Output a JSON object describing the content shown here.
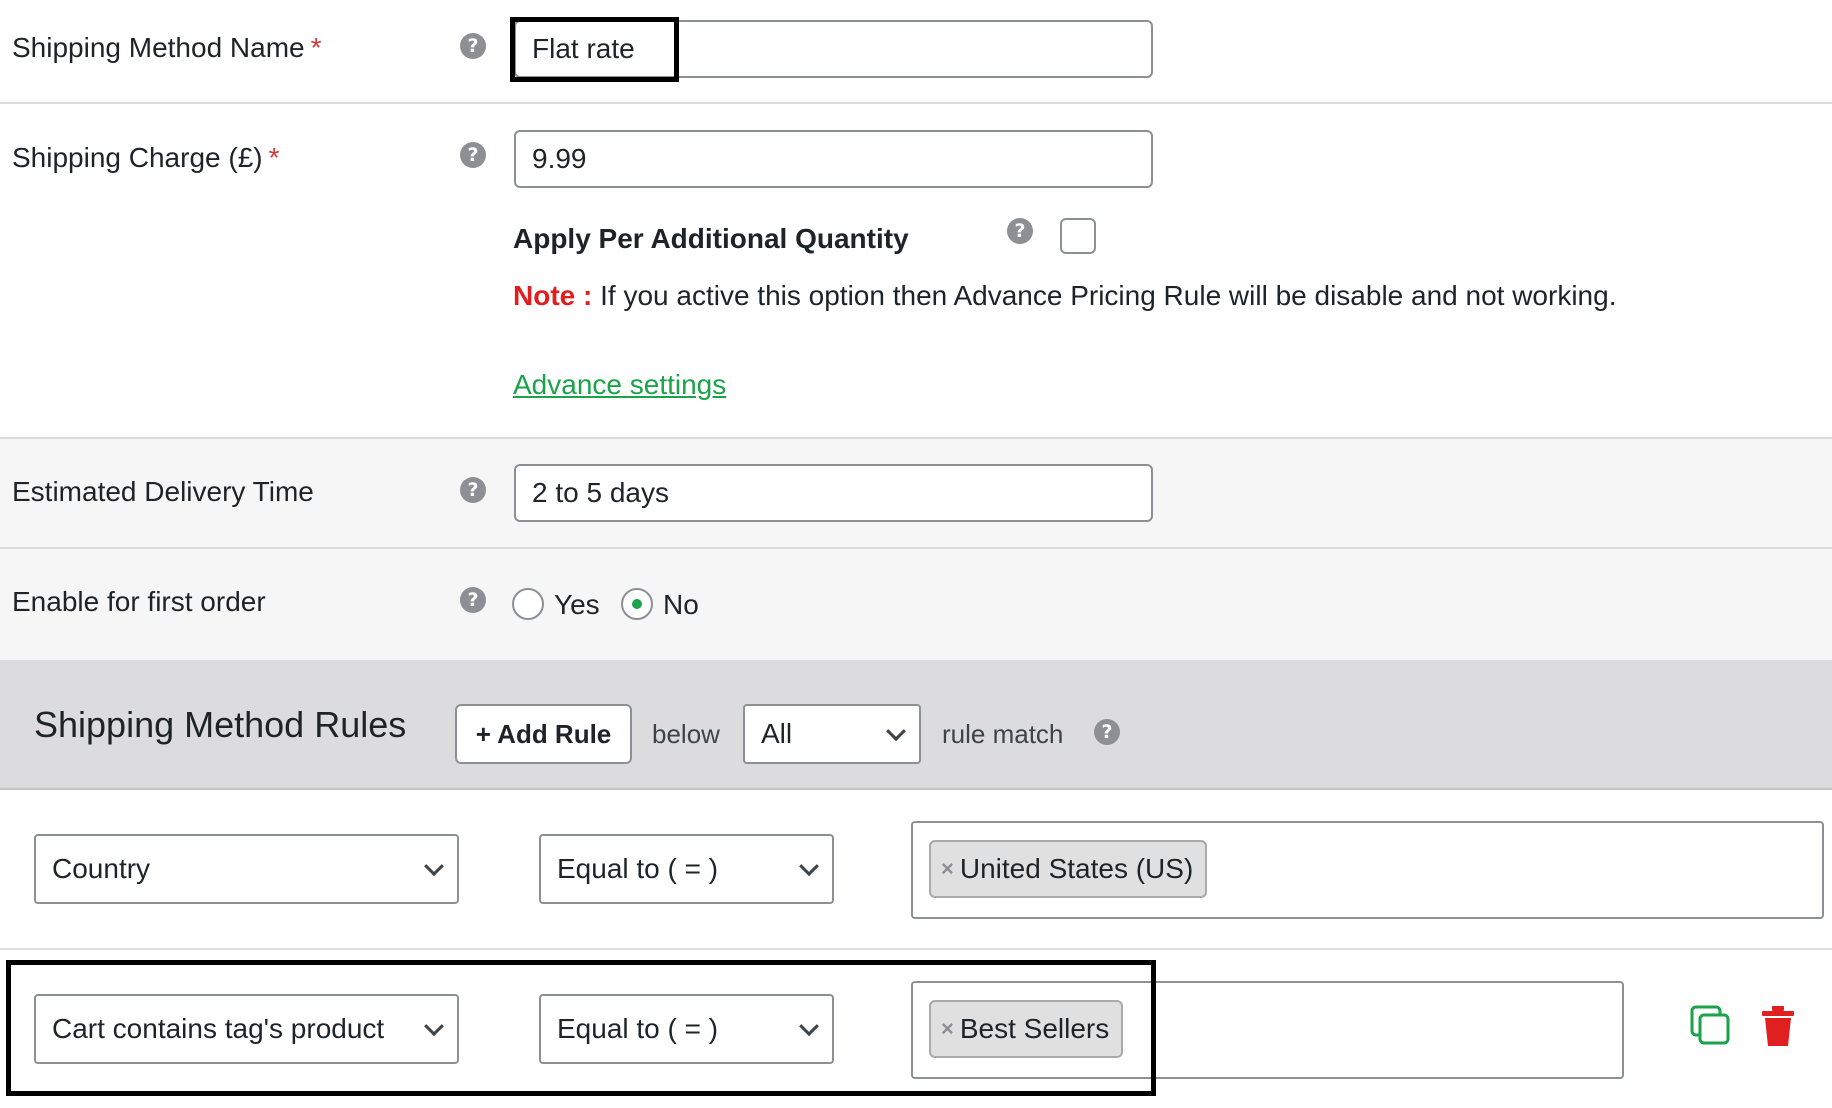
{
  "fields": {
    "method_name": {
      "label": "Shipping Method Name",
      "required_mark": "*",
      "value": "Flat rate"
    },
    "charge": {
      "label": "Shipping Charge (£)",
      "required_mark": "*",
      "value": "9.99"
    },
    "per_quantity": {
      "label": "Apply Per Additional Quantity",
      "checked": false
    },
    "note": {
      "prefix": "Note :",
      "text": "If you active this option then Advance Pricing Rule will be disable and not working."
    },
    "advance_link": "Advance settings",
    "delivery": {
      "label": "Estimated Delivery Time",
      "value": "2 to 5 days"
    },
    "first_order": {
      "label": "Enable for first order",
      "options": [
        "Yes",
        "No"
      ],
      "selected": "No"
    }
  },
  "rules": {
    "title": "Shipping Method Rules",
    "add_rule_label": "+ Add Rule",
    "below_text": "below",
    "match_select": "All",
    "rule_match_text": "rule match",
    "items": [
      {
        "condition": "Country",
        "operator": "Equal to ( = )",
        "tag_remove": "×",
        "tag": "United States (US)"
      },
      {
        "condition": "Cart contains tag's product",
        "operator": "Equal to ( = )",
        "tag_remove": "×",
        "tag": "Best Sellers"
      }
    ]
  },
  "icons": {
    "help": "question-circle-icon",
    "copy": "copy-icon",
    "delete": "trash-icon"
  },
  "colors": {
    "accent_green": "#1aa34a",
    "required_red": "#d63638",
    "note_red": "#e11d1d",
    "delete_red": "#e02020"
  }
}
